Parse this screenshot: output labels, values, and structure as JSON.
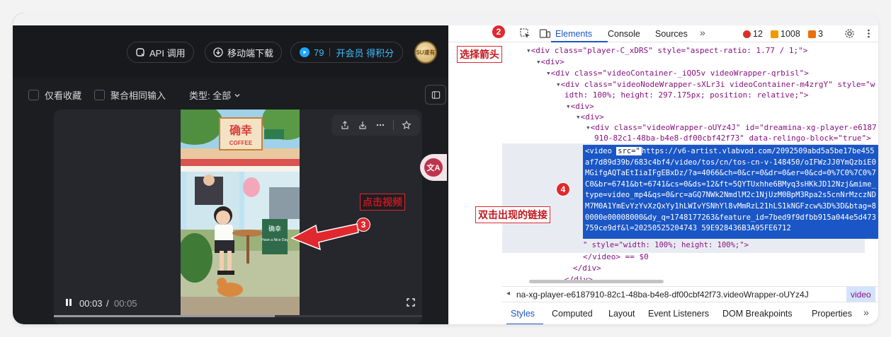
{
  "app": {
    "header": {
      "api_label": "API 调用",
      "mobile_label": "移动端下载",
      "points": "79",
      "member_label": "开会员 得积分",
      "avatar_text": "SU速有"
    },
    "filters": {
      "favorites_label": "仅看收藏",
      "merge_label": "聚合相同输入",
      "type_label": "类型: 全部"
    },
    "player": {
      "time_current": "00:03",
      "time_separator": "/",
      "time_total": "00:05",
      "progress_fraction": 0.6
    },
    "video": {
      "shop_sign": "确幸",
      "coffee_sign": "COFFEE",
      "board_sign": "确幸",
      "board_sub": "Have a Nice Day"
    },
    "translate_label": "文A"
  },
  "devtools": {
    "tabs": [
      "Elements",
      "Console",
      "Sources",
      "»"
    ],
    "counts": {
      "errors": "12",
      "warnings": "1008",
      "issues": "3"
    },
    "code": {
      "l1_tag": "<div class=\"player-C_xDRS\" style=\"aspect-ratio: 1.77 / 1;\">",
      "l2": "<div>",
      "l3": "<div class=\"videoContainer-_iQO5v videoWrapper-qrbisl\">",
      "l4a": "<div class=\"videoNodeWrapper-sXLr3i videoContainer-m4zrgY\" style=\"w",
      "l4b": "idth: 100%; height: 297.175px; position: relative;\">",
      "l5": "<div>",
      "l6": "<div>",
      "l7a": "<div class=\"videoWrapper-oUYz4J\" id=\"dreamina-xg-player-e6187",
      "l7b": "910-82c1-48ba-b4e8-df00cbf42f73\" data-relingo-block=\"true\">",
      "video_open": "<video ",
      "src_attr": "src=\"",
      "src_value": "https://v6-artist.vlabvod.com/2092509abd5a5be17be455af7d89d39b/683c4bf4/video/tos/cn/tos-cn-v-148450/oIFWzJJ0YmQzbiE0MGifgAQTaEtIiaIFgEBxDz/?a=4066&ch=0&cr=0&dr=0&er=0&cd=0%7C0%7C0%7C0&br=6741&bt=6741&cs=0&ds=12&ft=5QYTUxhhe6BMyq3sHKkJD12Nzj&mime_type=video_mp4&qs=0&rc=aGQ7NWk2NmdlM2c1NjUzM0BpM3Rpa2s5cnNrMzczNDM7M0A1YmEvYzYvXzQxYy1hLWIvYSNhYl8vMmRzL21hLS1kNGFzcw%3D%3D&btag=80000e00008000&dy_q=1748177263&feature_id=7bed9f9dfbb915a044e5d473759ce9df&l=20250525204743 59E928436B3A95FE6712",
      "style_tail": "\" style=\"width: 100%; height: 100%;\">",
      "video_close": "</video> == $0",
      "div_close1": "</div>",
      "div_close2": "</div>"
    },
    "breadcrumb": "na-xg-player-e6187910-82c1-48ba-b4e8-df00cbf42f73.videoWrapper-oUYz4J",
    "breadcrumb_last": "video",
    "bottom_tabs": [
      "Styles",
      "Computed",
      "Layout",
      "Event Listeners",
      "DOM Breakpoints",
      "Properties",
      "»"
    ]
  },
  "annotations": {
    "step2_num": "2",
    "step2_text": "选择箭头",
    "step3_num": "3",
    "step3_text": "点击视频",
    "step4_num": "4",
    "step4_text": "双击出现的链接"
  },
  "colors": {
    "accent": "#1a56c5",
    "annotation_red": "#e0282e",
    "app_bg": "#1c1d21"
  }
}
